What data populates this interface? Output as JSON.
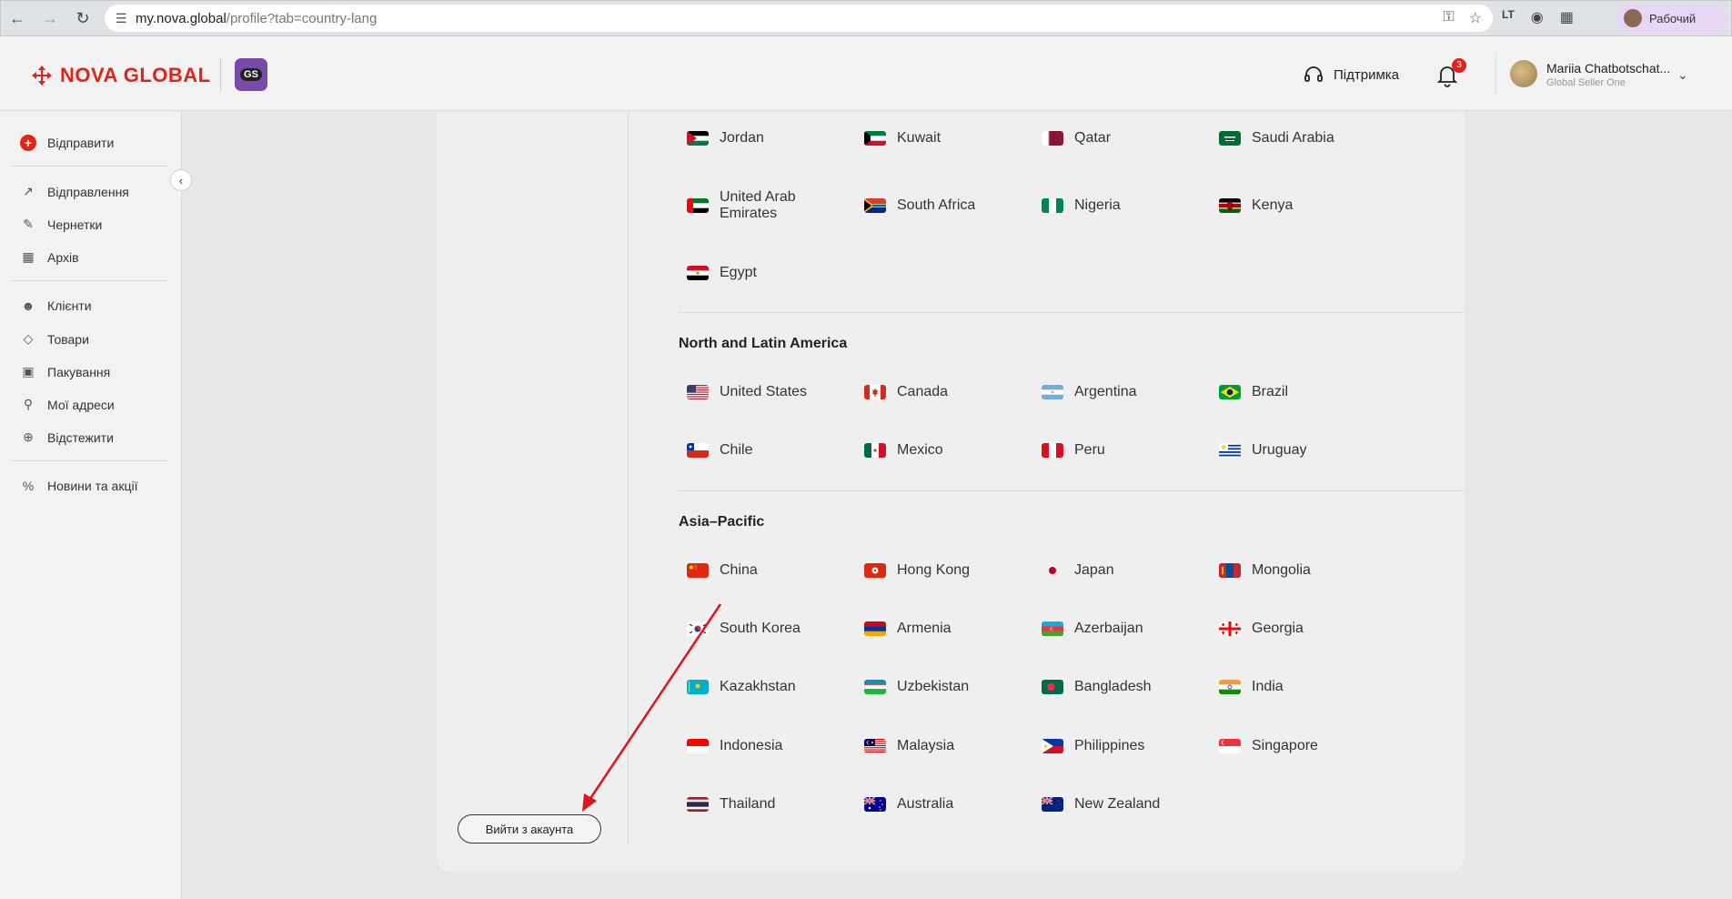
{
  "browser": {
    "url_host": "my.nova.global",
    "url_path": "/profile?tab=country-lang",
    "profile_label": "Рабочий"
  },
  "header": {
    "logo_text": "NOVA GLOBAL",
    "gs_badge": "GS",
    "support_label": "Підтримка",
    "notifications_count": "3",
    "user_name": "Mariia Chatbotschat...",
    "user_org": "Global Seller One"
  },
  "sidebar": {
    "send": "Відправити",
    "shipments": "Відправлення",
    "drafts": "Чернетки",
    "archive": "Архів",
    "clients": "Клієнти",
    "goods": "Товари",
    "packaging": "Пакування",
    "addresses": "Мої адреси",
    "track": "Відстежити",
    "news": "Новини та акції"
  },
  "main": {
    "logout_label": "Вийти з акаунта",
    "top_countries": [
      {
        "name": "Jordan",
        "flag": "jordan"
      },
      {
        "name": "Kuwait",
        "flag": "kuwait"
      },
      {
        "name": "Qatar",
        "flag": "qatar"
      },
      {
        "name": "Saudi Arabia",
        "flag": "saudi"
      },
      {
        "name": "United Arab Emirates",
        "flag": "uae"
      },
      {
        "name": "South Africa",
        "flag": "southafrica"
      },
      {
        "name": "Nigeria",
        "flag": "nigeria"
      },
      {
        "name": "Kenya",
        "flag": "kenya"
      },
      {
        "name": "Egypt",
        "flag": "egypt"
      }
    ],
    "americas_title": "North and Latin America",
    "americas": [
      {
        "name": "United States",
        "flag": "us"
      },
      {
        "name": "Canada",
        "flag": "canada"
      },
      {
        "name": "Argentina",
        "flag": "argentina"
      },
      {
        "name": "Brazil",
        "flag": "brazil"
      },
      {
        "name": "Chile",
        "flag": "chile"
      },
      {
        "name": "Mexico",
        "flag": "mexico"
      },
      {
        "name": "Peru",
        "flag": "peru"
      },
      {
        "name": "Uruguay",
        "flag": "uruguay"
      }
    ],
    "asia_title": "Asia–Pacific",
    "asia": [
      {
        "name": "China",
        "flag": "china"
      },
      {
        "name": "Hong Kong",
        "flag": "hongkong"
      },
      {
        "name": "Japan",
        "flag": "japan"
      },
      {
        "name": "Mongolia",
        "flag": "mongolia"
      },
      {
        "name": "South Korea",
        "flag": "korea"
      },
      {
        "name": "Armenia",
        "flag": "armenia"
      },
      {
        "name": "Azerbaijan",
        "flag": "azerbaijan"
      },
      {
        "name": "Georgia",
        "flag": "georgia"
      },
      {
        "name": "Kazakhstan",
        "flag": "kazakhstan"
      },
      {
        "name": "Uzbekistan",
        "flag": "uzbekistan"
      },
      {
        "name": "Bangladesh",
        "flag": "bangladesh"
      },
      {
        "name": "India",
        "flag": "india"
      },
      {
        "name": "Indonesia",
        "flag": "indonesia"
      },
      {
        "name": "Malaysia",
        "flag": "malaysia"
      },
      {
        "name": "Philippines",
        "flag": "philippines"
      },
      {
        "name": "Singapore",
        "flag": "singapore"
      },
      {
        "name": "Thailand",
        "flag": "thailand"
      },
      {
        "name": "Australia",
        "flag": "australia"
      },
      {
        "name": "New Zealand",
        "flag": "newzealand"
      }
    ]
  },
  "colors": {
    "brand": "#e2231a",
    "annotation_arrow": "#e0141e"
  }
}
